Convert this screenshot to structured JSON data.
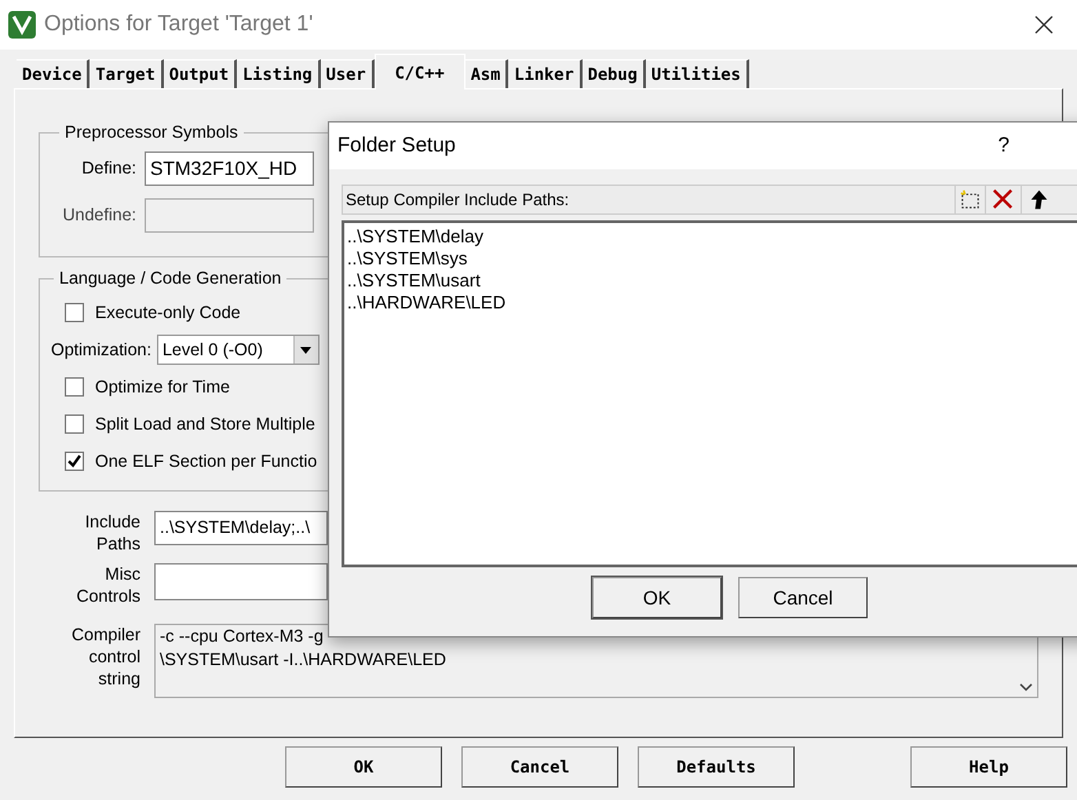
{
  "window": {
    "title": "Options for Target 'Target 1'"
  },
  "tabs": [
    {
      "label": "Device",
      "selected": false
    },
    {
      "label": "Target",
      "selected": false
    },
    {
      "label": "Output",
      "selected": false
    },
    {
      "label": "Listing",
      "selected": false
    },
    {
      "label": "User",
      "selected": false
    },
    {
      "label": "C/C++",
      "selected": true
    },
    {
      "label": "Asm",
      "selected": false
    },
    {
      "label": "Linker",
      "selected": false
    },
    {
      "label": "Debug",
      "selected": false
    },
    {
      "label": "Utilities",
      "selected": false
    }
  ],
  "preprocessor": {
    "title": "Preprocessor Symbols",
    "define": {
      "label": "Define:",
      "value": "STM32F10X_HD"
    },
    "undefine": {
      "label": "Undefine:",
      "disabled": true
    }
  },
  "code_generation": {
    "title": "Language / Code Generation",
    "options": [
      {
        "kind": "checkbox",
        "label": "Execute-only Code",
        "checked": false
      },
      {
        "kind": "select",
        "label": "Optimization:",
        "value": "Level 0 (-O0)"
      },
      {
        "kind": "checkbox",
        "label": "Optimize for Time",
        "checked": false
      },
      {
        "kind": "checkbox",
        "label": "Split Load and Store Multiple",
        "checked": false
      },
      {
        "kind": "checkbox",
        "label": "One ELF Section per Functio",
        "checked": true
      }
    ]
  },
  "include_paths": {
    "label_lines": [
      "Include",
      "Paths"
    ],
    "value": "..\\SYSTEM\\delay;..\\"
  },
  "misc_controls": {
    "label_lines": [
      "Misc",
      "Controls"
    ]
  },
  "compiler_string": {
    "label_lines": [
      "Compiler",
      "control",
      "string"
    ],
    "lines": [
      "-c --cpu Cortex-M3 -g",
      "\\SYSTEM\\usart -I..\\HARDWARE\\LED"
    ]
  },
  "buttons": [
    "OK",
    "Cancel",
    "Defaults",
    "Help"
  ],
  "folder_setup": {
    "title": "Folder Setup",
    "help": "?",
    "header": "Setup Compiler Include Paths:",
    "paths": [
      "..\\SYSTEM\\delay",
      "..\\SYSTEM\\sys",
      "..\\SYSTEM\\usart",
      "..\\HARDWARE\\LED"
    ],
    "buttons": [
      "OK",
      "Cancel"
    ]
  }
}
